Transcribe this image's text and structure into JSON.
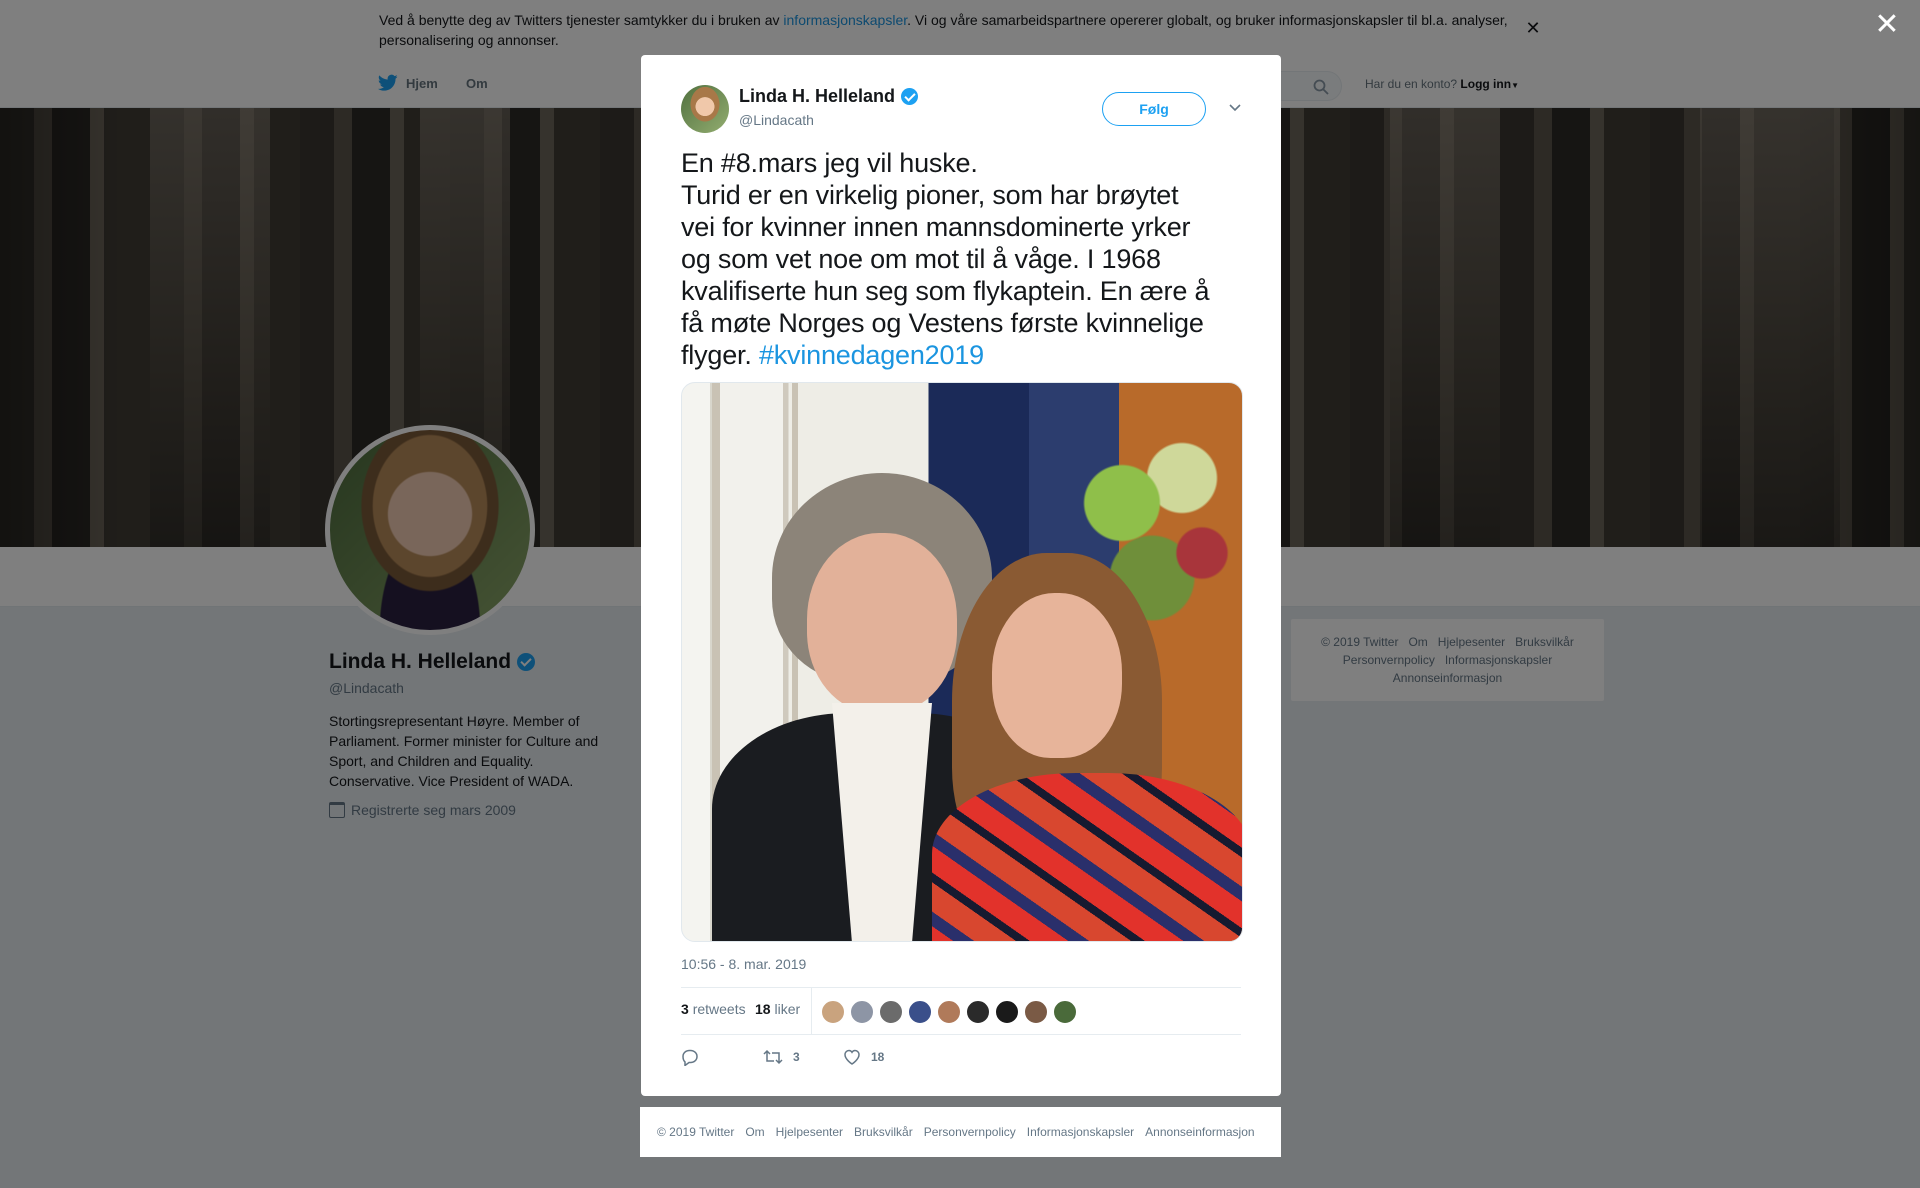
{
  "cookie_banner": {
    "text_before": "Ved å benytte deg av Twitters tjenester samtykker du i bruken av ",
    "link": "informasjonskapsler",
    "text_after": ". Vi og våre samarbeidspartnere opererer globalt, og bruker informasjonskapsler til bl.a. analyser, personalisering og annonser.",
    "close_icon": "close-icon"
  },
  "topnav": {
    "home_label": "Hjem",
    "about_label": "Om",
    "account_question": "Har du en konto?",
    "login_label": "Logg inn",
    "icons": [
      "twitter-bird-icon",
      "search-icon",
      "caret-down-icon"
    ]
  },
  "profile": {
    "name": "Linda H. Helleland",
    "handle": "@Lindacath",
    "bio": "Stortingsrepresentant Høyre. Member of Parliament. Former minister for Culture and Sport, and Children and Equality. Conservative. Vice President of WADA.",
    "joined": "Registrerte seg mars 2009",
    "verified": true
  },
  "side_footer": {
    "items": [
      "© 2019 Twitter",
      "Om",
      "Hjelpesenter",
      "Bruksvilkår",
      "Personvernpolicy",
      "Informasjonskapsler",
      "Annonseinformasjon"
    ]
  },
  "tweet": {
    "author_name": "Linda H. Helleland",
    "author_handle": "@Lindacath",
    "follow_label": "Følg",
    "lines": [
      "En #8.mars jeg vil huske.",
      "Turid er en virkelig pioner, som har brøytet",
      "vei for kvinner innen mannsdominerte yrker",
      "og som vet noe om mot til å våge. I 1968",
      "kvalifiserte hun seg som flykaptein. En ære å",
      "få møte Norges og Vestens første kvinnelige"
    ],
    "last_line_text": "flyger. ",
    "hashtag": "#kvinnedagen2019",
    "timestamp": "10:56 - 8. mar. 2019",
    "retweets_count": "3",
    "retweets_label": "retweets",
    "likes_count": "18",
    "likes_label": "liker",
    "reply_icon": "reply-icon",
    "retweet_action_count": "3",
    "like_action_count": "18",
    "liker_avatar_colors": [
      "#c9a37e",
      "#8d95a5",
      "#6b6b6b",
      "#3a4f8a",
      "#b07a5a",
      "#2a2a2a",
      "#1a1a1a",
      "#7a5a45",
      "#4a6a3a"
    ]
  },
  "modal_footer": {
    "items": [
      "© 2019 Twitter",
      "Om",
      "Hjelpesenter",
      "Bruksvilkår",
      "Personvernpolicy",
      "Informasjonskapsler",
      "Annonseinformasjon"
    ]
  },
  "colors": {
    "accent": "#1da1f2",
    "link": "#1b95e0",
    "overlay": "rgba(0,0,0,0.5)"
  }
}
